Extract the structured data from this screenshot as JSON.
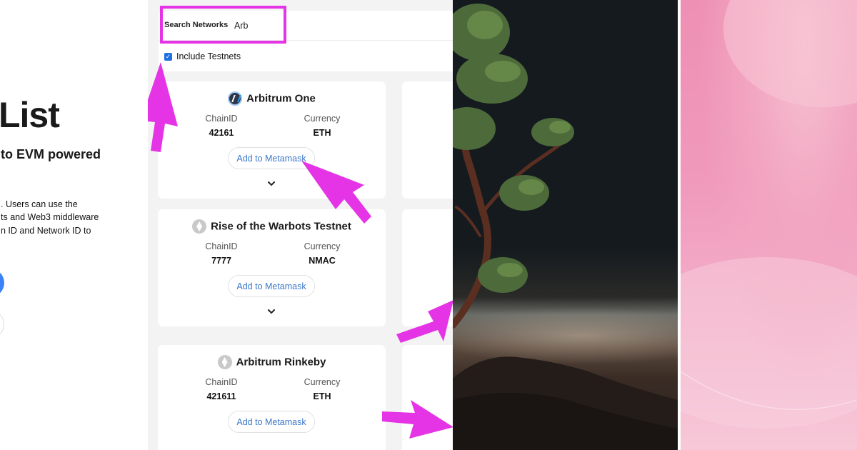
{
  "hero": {
    "title_fragment": "List",
    "subtitle_fragment": "to EVM powered",
    "text_lines": [
      ". Users can use the",
      "ts and Web3 middleware",
      "n ID and Network ID to"
    ]
  },
  "search": {
    "label": "Search Networks",
    "value": "Arb",
    "include_testnets_label": "Include Testnets",
    "include_testnets_checked": true
  },
  "labels": {
    "chain_id": "ChainID",
    "currency": "Currency",
    "add_button": "Add to Metamask"
  },
  "chains": [
    {
      "name": "Arbitrum One",
      "chain_id": "42161",
      "currency": "ETH",
      "icon": "arbitrum-logo-icon"
    },
    {
      "name": "Rise of the Warbots Testnet",
      "chain_id": "7777",
      "currency": "NMAC",
      "icon": "ethereum-logo-icon"
    },
    {
      "name": "Arbitrum Rinkeby",
      "chain_id": "421611",
      "currency": "ETH",
      "icon": "ethereum-logo-icon"
    }
  ],
  "colors": {
    "annotation_arrow": "#e534e5",
    "checkbox": "#1e6fe0",
    "link_button_text": "#3d78c8",
    "hero_primary_button": "#3b82f6",
    "app_background": "#f3f3f4",
    "pink_panel": "#f099bb",
    "tree_sky": "#151a1f"
  }
}
